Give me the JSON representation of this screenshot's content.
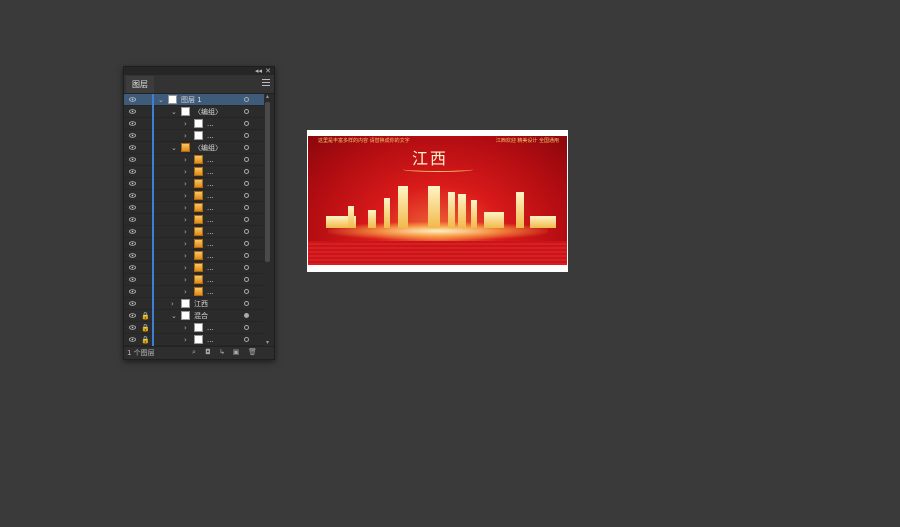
{
  "panel": {
    "tab_label": "图层",
    "collapse_glyph": "◂◂",
    "close_glyph": "✕",
    "footer_count": "1 个图层",
    "colors": {
      "selection": "#3f5b7a",
      "layer_color_bar": "#3d7fd1",
      "panel_bg": "#2b2b2b"
    }
  },
  "layers": [
    {
      "name": "图层 1",
      "expanded": true,
      "selected": true,
      "thumb": "plain",
      "locked": false
    },
    {
      "name": "〈编组〉",
      "expanded": true,
      "thumb": "plain",
      "locked": false
    },
    {
      "name": "...",
      "expanded": false,
      "thumb": "plain",
      "locked": false
    },
    {
      "name": "...",
      "expanded": false,
      "thumb": "plain",
      "locked": false
    },
    {
      "name": "〈编组〉",
      "expanded": true,
      "thumb": "image",
      "locked": false
    },
    {
      "name": "...",
      "expanded": false,
      "thumb": "image",
      "locked": false
    },
    {
      "name": "...",
      "expanded": false,
      "thumb": "image",
      "locked": false
    },
    {
      "name": "...",
      "expanded": false,
      "thumb": "image",
      "locked": false
    },
    {
      "name": "...",
      "expanded": false,
      "thumb": "image",
      "locked": false
    },
    {
      "name": "...",
      "expanded": false,
      "thumb": "image",
      "locked": false
    },
    {
      "name": "...",
      "expanded": false,
      "thumb": "image",
      "locked": false
    },
    {
      "name": "...",
      "expanded": false,
      "thumb": "image",
      "locked": false
    },
    {
      "name": "...",
      "expanded": false,
      "thumb": "image",
      "locked": false
    },
    {
      "name": "...",
      "expanded": false,
      "thumb": "image",
      "locked": false
    },
    {
      "name": "...",
      "expanded": false,
      "thumb": "image",
      "locked": false
    },
    {
      "name": "...",
      "expanded": false,
      "thumb": "image",
      "locked": false
    },
    {
      "name": "...",
      "expanded": false,
      "thumb": "image",
      "locked": false
    },
    {
      "name": "江西",
      "expanded": false,
      "thumb": "plain",
      "locked": false
    },
    {
      "name": "混合",
      "expanded": true,
      "thumb": "plain",
      "locked": true
    },
    {
      "name": "...",
      "expanded": false,
      "thumb": "plain",
      "locked": true
    },
    {
      "name": "...",
      "expanded": false,
      "thumb": "plain",
      "locked": true
    }
  ],
  "artwork": {
    "title": "江西",
    "header_left": "这里是丰富多样的内容 请替换成你的文字",
    "header_right": "江西欢迎 精美设计 全国通用"
  }
}
